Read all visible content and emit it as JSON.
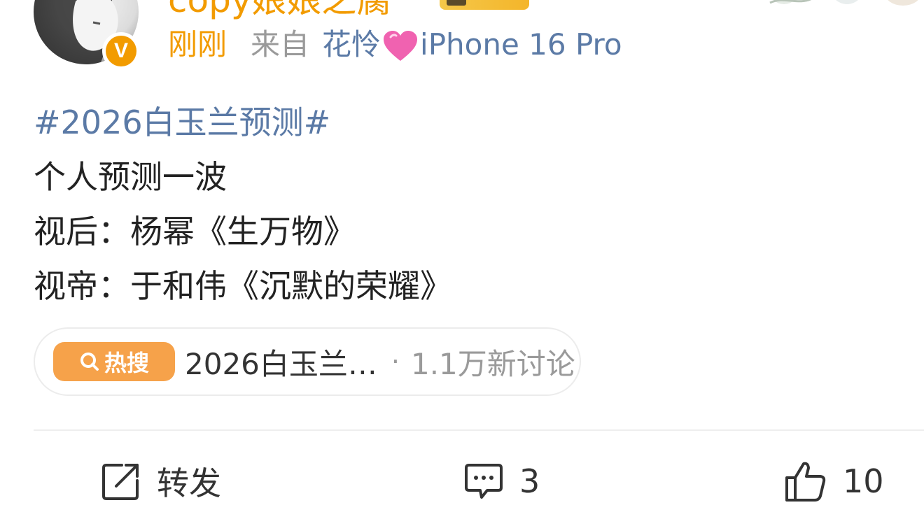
{
  "post": {
    "username": "copy娘娘之腐",
    "time": "刚刚",
    "from_label": "来自",
    "device_prefix": "花怜",
    "device_name": "iPhone 16 Pro",
    "verified_mark": "V",
    "topic": "#2026白玉兰预测#",
    "lines": [
      "个人预测一波",
      "视后：杨幂《生万物》",
      "视帝：于和伟《沉默的荣耀》"
    ]
  },
  "hot_search": {
    "badge_label": "热搜",
    "title": "2026白玉兰…",
    "separator": "·",
    "count": "1.1万新讨论"
  },
  "actions": {
    "repost_label": "转发",
    "comment_count": "3",
    "like_count": "10"
  },
  "colors": {
    "accent_orange": "#f29b00",
    "link_blue": "#5b7aa6",
    "meta_gray": "#9a9a9a",
    "hot_badge": "#f6a24a",
    "heart_pink": "#f062b0"
  },
  "icons": {
    "repost": "edit-share-icon",
    "comment": "comment-bubble-icon",
    "like": "thumbs-up-icon",
    "heart": "pink-heart-icon",
    "hot": "search-icon"
  }
}
